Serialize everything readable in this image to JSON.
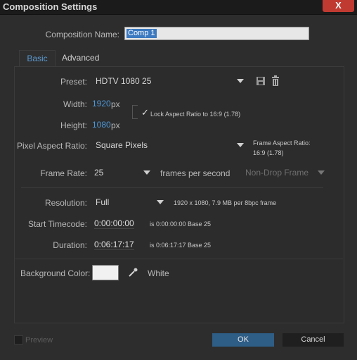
{
  "window": {
    "title": "Composition Settings",
    "close_label": "X"
  },
  "name_row": {
    "label": "Composition Name:",
    "value": "Comp 1"
  },
  "tabs": [
    {
      "label": "Basic"
    },
    {
      "label": "Advanced"
    }
  ],
  "preset": {
    "label": "Preset:",
    "value": "HDTV 1080 25"
  },
  "width": {
    "label": "Width:",
    "value": "1920",
    "unit": "px"
  },
  "height": {
    "label": "Height:",
    "value": "1080",
    "unit": "px"
  },
  "lock_aspect": {
    "checkmark": "✓",
    "label": "Lock Aspect Ratio to 16:9 (1.78)"
  },
  "pixel_aspect": {
    "label": "Pixel Aspect Ratio:",
    "value": "Square Pixels",
    "frame_aspect_line1": "Frame Aspect Ratio:",
    "frame_aspect_line2": "16:9 (1.78)"
  },
  "frame_rate": {
    "label": "Frame Rate:",
    "value": "25",
    "unit": "frames per second",
    "drop_frame": "Non-Drop Frame"
  },
  "resolution": {
    "label": "Resolution:",
    "value": "Full",
    "info": "1920 x 1080, 7.9 MB per 8bpc frame"
  },
  "start_timecode": {
    "label": "Start Timecode:",
    "value": "0:00:00:00",
    "info": "is 0:00:00:00  Base 25"
  },
  "duration": {
    "label": "Duration:",
    "value": "0:06:17:17",
    "info": "is 0:06:17:17  Base 25"
  },
  "background": {
    "label": "Background Color:",
    "color_name": "White",
    "swatch_color": "#f1f1f1"
  },
  "footer": {
    "preview_label": "Preview",
    "ok_label": "OK",
    "cancel_label": "Cancel"
  }
}
